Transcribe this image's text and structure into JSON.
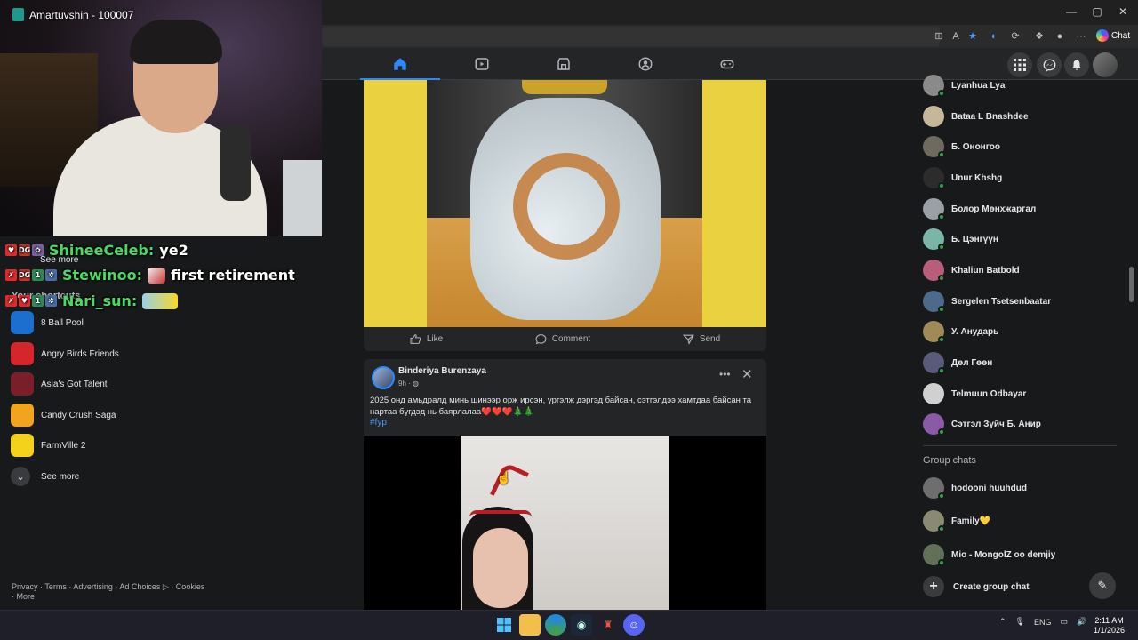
{
  "stream": {
    "streamer": "Amartuvshin - 100007",
    "chat": [
      {
        "user": "ShineeCeleb:",
        "message": "ye2"
      },
      {
        "user": "Stewinoo:",
        "message": "first retirement"
      },
      {
        "user": "Nari_sun:",
        "message": ""
      }
    ]
  },
  "browser": {
    "chat_label": "Chat",
    "window_controls": [
      "—",
      "▢",
      "✕"
    ]
  },
  "left_sidebar": {
    "see_more_top": "See more",
    "shortcuts_heading": "Your shortcuts",
    "shortcuts": [
      {
        "label": "8 Ball Pool",
        "color": "#1b6fcf"
      },
      {
        "label": "Angry Birds Friends",
        "color": "#d6262b"
      },
      {
        "label": "Asia's Got Talent",
        "color": "#7a1f2a"
      },
      {
        "label": "Candy Crush Saga",
        "color": "#f3a41f"
      },
      {
        "label": "FarmVille 2",
        "color": "#f4d21c"
      }
    ],
    "see_more": "See more",
    "footer": "Privacy · Terms · Advertising · Ad Choices ▷ · Cookies · More"
  },
  "feed": {
    "post1": {
      "like": "Like",
      "comment": "Comment",
      "send": "Send"
    },
    "post2": {
      "author": "Binderiya Burenzaya",
      "time": "9h · ",
      "text": "2025 онд амьдралд минь шинээр орж ирсэн, үргэлж дэргэд байсан, сэтгэлдээ хамтдаа байсан та нартаа бүгдэд нь баярлалаа❤️❤️❤️🎄🎄",
      "hashtag": "#fyp"
    }
  },
  "contacts": [
    {
      "name": "Lyanhua Lya",
      "online": true,
      "color": "#8a8a8a"
    },
    {
      "name": "Bataa L Bnashdee",
      "online": false,
      "color": "#c7b79a"
    },
    {
      "name": "Б. Ононгоо",
      "online": true,
      "color": "#6f6a60"
    },
    {
      "name": "Unur Khshg",
      "online": true,
      "color": "#2c2c2c"
    },
    {
      "name": "Болор Мөнхжаргал",
      "online": true,
      "color": "#9aa0a6"
    },
    {
      "name": "Б. Цэнгүүн",
      "online": true,
      "color": "#7ab6a8"
    },
    {
      "name": "Khaliun Batbold",
      "online": true,
      "color": "#b85d7a"
    },
    {
      "name": "Sergelen Tsetsenbaatar",
      "online": true,
      "color": "#4d6a8a"
    },
    {
      "name": "У. Анударь",
      "online": true,
      "color": "#a08a56"
    },
    {
      "name": "Дөл Гөөн",
      "online": true,
      "color": "#5a5a7a"
    },
    {
      "name": "Telmuun Odbayar",
      "online": false,
      "color": "#d0d0d0"
    },
    {
      "name": "Сэтгэл Зүйч Б. Анир",
      "online": true,
      "color": "#8b5aa6"
    }
  ],
  "group_chats": {
    "heading": "Group chats",
    "items": [
      {
        "name": "hodooni huuhdud",
        "color": "#6e6e6e"
      },
      {
        "name": "Family💛",
        "color": "#8a8a72"
      },
      {
        "name": "Mio - MongolZ oo demjiy",
        "color": "#62705a"
      }
    ],
    "create": "Create group chat"
  },
  "taskbar": {
    "lang": "ENG",
    "time": "2:11 AM",
    "date": "1/1/2026"
  }
}
